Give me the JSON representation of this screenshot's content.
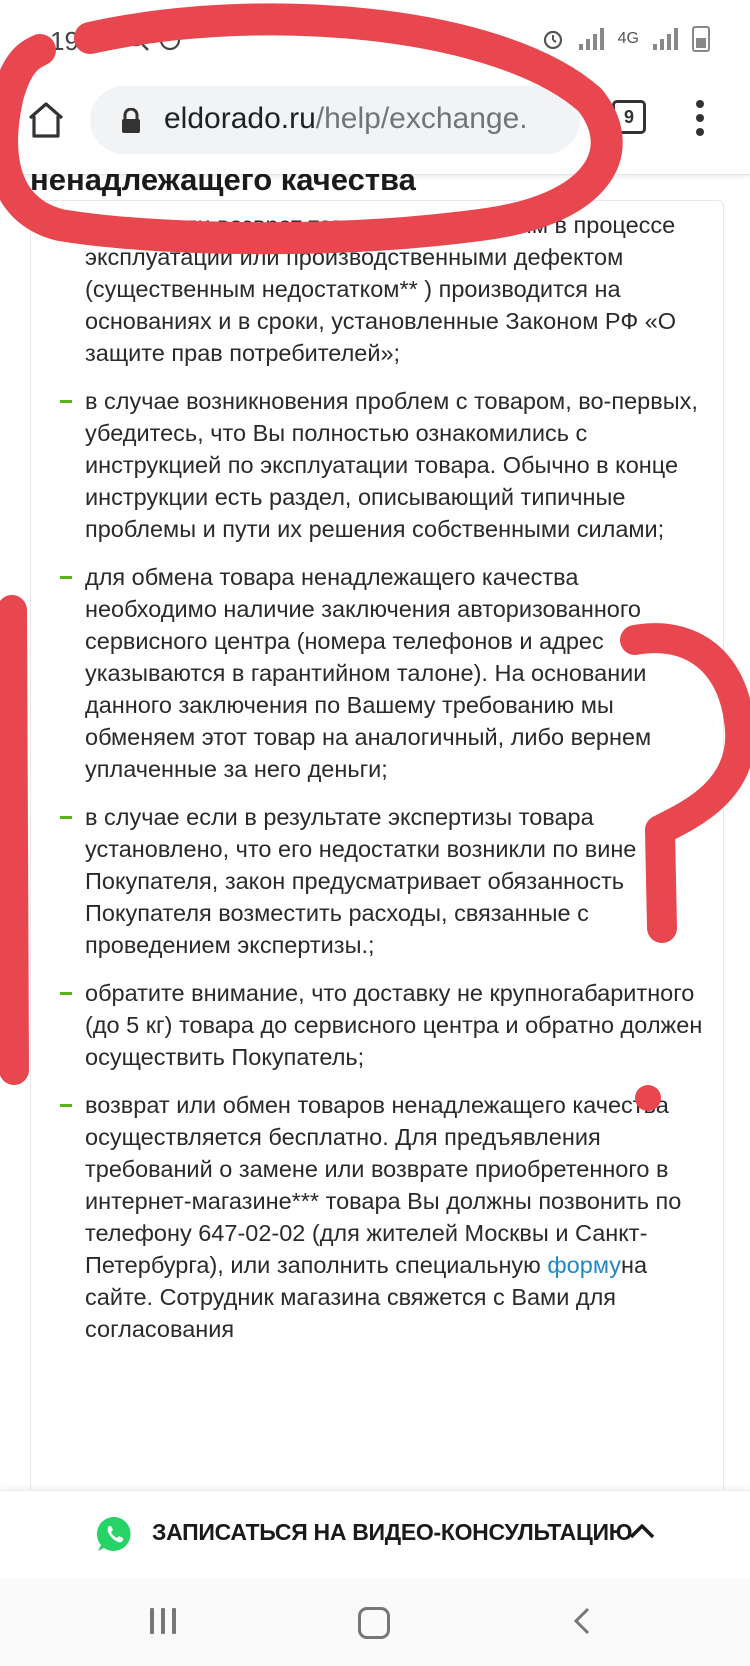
{
  "status_bar": {
    "time": "19:34",
    "network": "4G"
  },
  "browser": {
    "url_domain": "eldorado.ru",
    "url_path": "/help/exchange.",
    "tab_count": "9"
  },
  "page": {
    "heading": "ненадлежащего качества",
    "items": [
      {
        "text": "замена или возврат товара с выявленным в процессе эксплуатации или производственными дефектом (существенным недостатком** ) производится на основаниях и в сроки, установленные Законом РФ «О защите прав потребителей»;"
      },
      {
        "text": "в случае возникновения проблем с товаром, во-первых, убедитесь, что Вы полностью ознакомились с инструкцией по эксплуатации товара. Обычно в конце инструкции есть раздел, описывающий типичные проблемы и пути их решения собственными силами;"
      },
      {
        "text": "для обмена товара ненадлежащего качества необходимо наличие заключения авторизованного сервисного центра (номера телефонов и адрес указываются в гарантийном талоне). На основании данного заключения по Вашему требованию мы обменяем этот товар на аналогичный, либо вернем уплаченные за него деньги;"
      },
      {
        "text": "в случае если в результате экспертизы товара установлено, что его недостатки возникли по вине Покупателя, закон предусматривает обязанность Покупателя возместить расходы, связанные с проведением экспертизы.;"
      },
      {
        "text": "обратите внимание, что доставку не крупногабаритного (до 5 кг) товара до сервисного центра и обратно должен осуществить Покупатель;"
      },
      {
        "text_before": "возврат или обмен товаров ненадлежащего качества осуществляется бесплатно. Для предъявления требований о замене или возврате приобретенного в интернет-магазине*** товара Вы должны позвонить по телефону 647-02-02 (для жителей Москвы и Санкт-Петербурга), или заполнить специальную ",
        "link": "форму",
        "text_after": "на сайте. Сотрудник магазина свяжется с Вами для согласования"
      }
    ]
  },
  "banner": {
    "label": "ЗАПИСАТЬСЯ НА ВИДЕО-КОНСУЛЬТАЦИЮ"
  },
  "colors": {
    "accent_green": "#5cb314",
    "link_blue": "#1e88c8",
    "whatsapp": "#25d366",
    "annotation_red": "#e8474f"
  },
  "icons": [
    "search-icon",
    "whatsapp-status-icon",
    "alarm-icon",
    "signal-icon",
    "battery-icon",
    "home-icon",
    "lock-icon",
    "tabs-icon",
    "overflow-menu-icon",
    "whatsapp-icon",
    "chevron-up-icon",
    "recent-apps-icon",
    "home-circle-icon",
    "back-icon"
  ]
}
